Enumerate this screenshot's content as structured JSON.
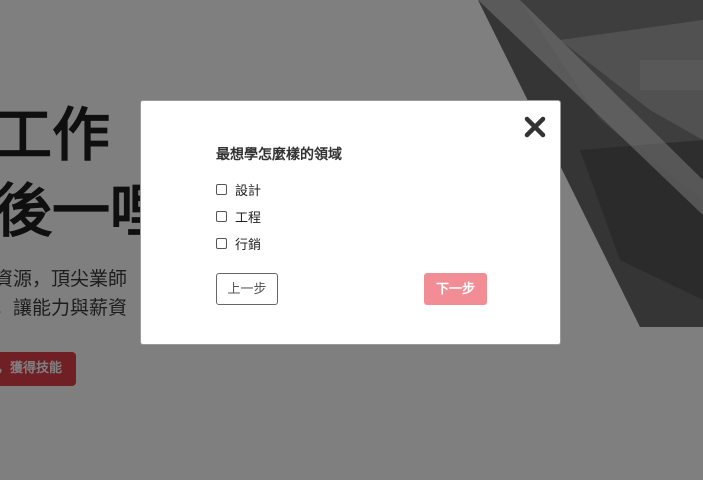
{
  "hero": {
    "title_line1": "工作",
    "title_line2": "後一哩",
    "desc_line1": "資源，頂尖業師",
    "desc_line2": "，讓能力與薪資",
    "cta_label": "，獲得技能"
  },
  "modal": {
    "question": "最想學怎麼樣的領域",
    "options": [
      {
        "label": "設計",
        "checked": false
      },
      {
        "label": "工程",
        "checked": false
      },
      {
        "label": "行銷",
        "checked": false
      }
    ],
    "prev_label": "上一步",
    "next_label": "下一步",
    "close_icon": "close-icon"
  },
  "colors": {
    "accent": "#e0414a",
    "next_button": "#f38d95",
    "overlay": "rgba(0,0,0,0.5)"
  }
}
